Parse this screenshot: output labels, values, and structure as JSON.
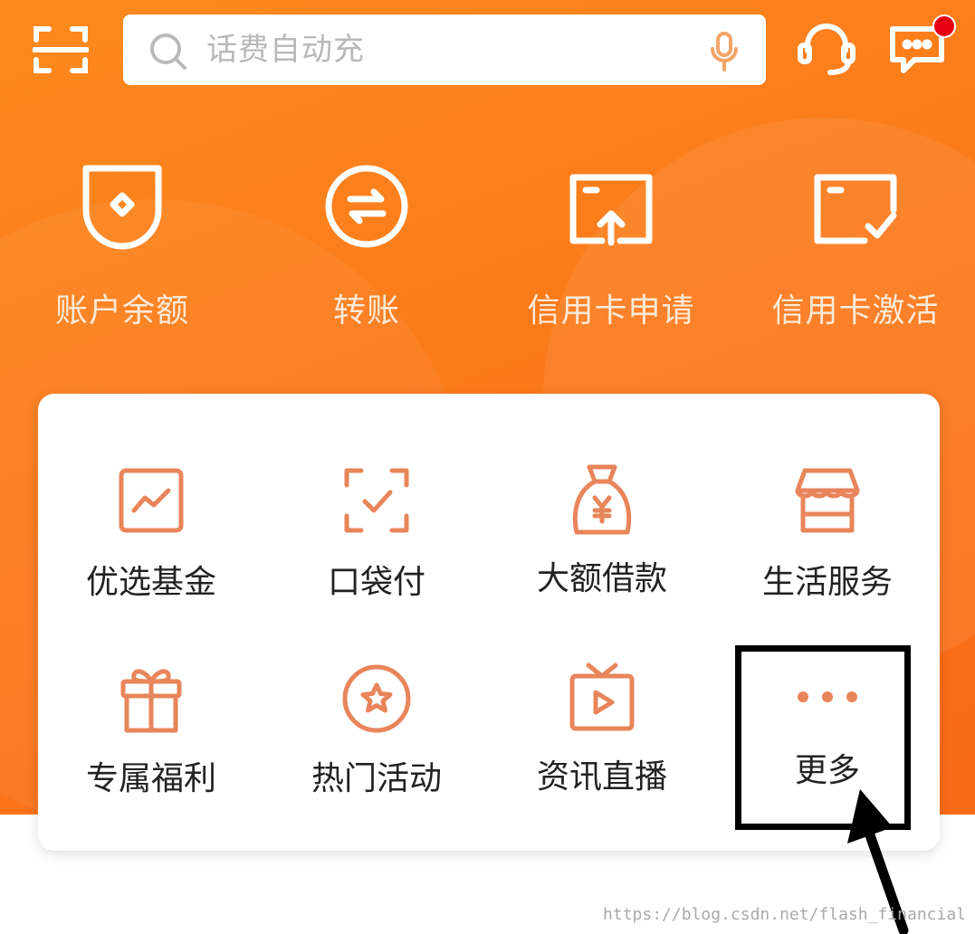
{
  "search": {
    "placeholder": "话费自动充"
  },
  "topbar": {
    "scan_icon": "scan-icon",
    "voice_icon": "microphone-icon",
    "service_icon": "headset-icon",
    "message_icon": "message-icon",
    "message_badge_color": "#e60012"
  },
  "quick_actions": [
    {
      "label": "账户余额",
      "icon": "account-balance-icon"
    },
    {
      "label": "转账",
      "icon": "transfer-icon"
    },
    {
      "label": "信用卡申请",
      "icon": "credit-card-apply-icon"
    },
    {
      "label": "信用卡激活",
      "icon": "credit-card-activate-icon"
    }
  ],
  "services": [
    {
      "label": "优选基金",
      "icon": "fund-chart-icon"
    },
    {
      "label": "口袋付",
      "icon": "scan-pay-icon"
    },
    {
      "label": "大额借款",
      "icon": "money-bag-icon"
    },
    {
      "label": "生活服务",
      "icon": "store-icon"
    },
    {
      "label": "专属福利",
      "icon": "gift-icon"
    },
    {
      "label": "热门活动",
      "icon": "star-badge-icon"
    },
    {
      "label": "资讯直播",
      "icon": "tv-play-icon"
    },
    {
      "label": "更多",
      "icon": "more-dots-icon"
    }
  ],
  "colors": {
    "brand_orange": "#fb7a1a",
    "icon_orange": "#e8855a",
    "annotation": "#000000"
  },
  "watermark": "https://blog.csdn.net/flash_financial"
}
